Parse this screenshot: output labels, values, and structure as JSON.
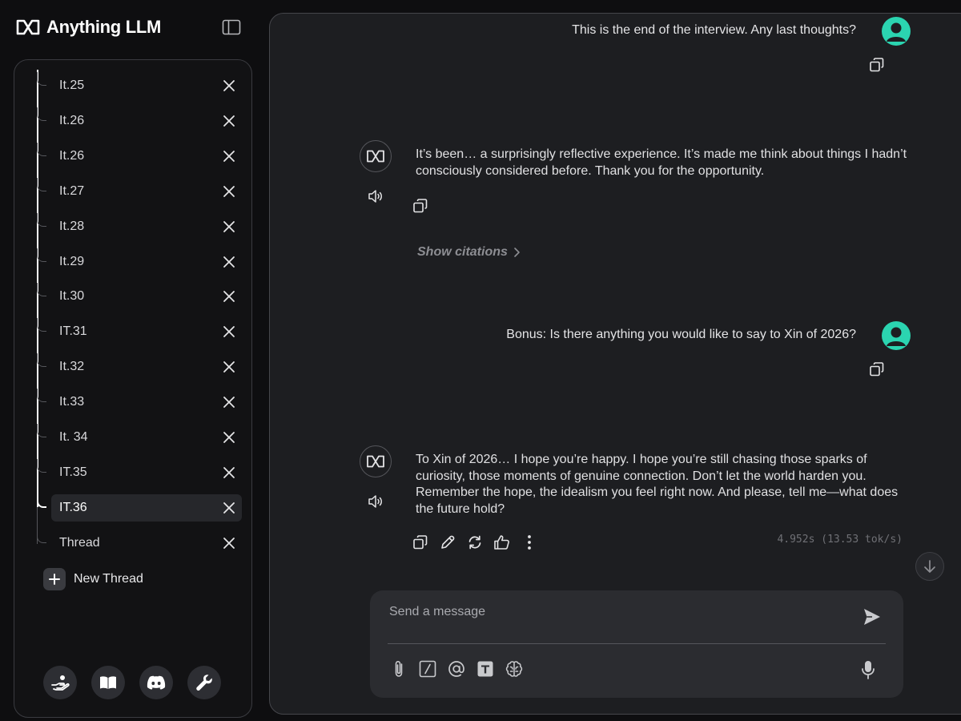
{
  "app": {
    "title": "Anything LLM"
  },
  "sidebar": {
    "threads": [
      {
        "label": "It.25",
        "active": false
      },
      {
        "label": "It.26",
        "active": false
      },
      {
        "label": "It.26",
        "active": false
      },
      {
        "label": "It.27",
        "active": false
      },
      {
        "label": "It.28",
        "active": false
      },
      {
        "label": "It.29",
        "active": false
      },
      {
        "label": "It.30",
        "active": false
      },
      {
        "label": "IT.31",
        "active": false
      },
      {
        "label": "It.32",
        "active": false
      },
      {
        "label": "It.33",
        "active": false
      },
      {
        "label": "It. 34",
        "active": false
      },
      {
        "label": "IT.35",
        "active": false
      },
      {
        "label": "IT.36",
        "active": true
      },
      {
        "label": "Thread",
        "active": false
      }
    ],
    "new_thread_label": "New Thread",
    "footer_icons": [
      "support-icon",
      "docs-icon",
      "discord-icon",
      "settings-wrench-icon"
    ]
  },
  "chat": {
    "messages": [
      {
        "role": "user",
        "text": "This is the end of the interview. Any last thoughts?"
      },
      {
        "role": "assistant",
        "text": "It’s been… a surprisingly reflective experience. It’s made me think about things I hadn’t consciously considered before. Thank you for the opportunity.",
        "citations_label": "Show citations"
      },
      {
        "role": "user",
        "text": "Bonus: Is there anything you would like to say to Xin of 2026?"
      },
      {
        "role": "assistant",
        "text": "To Xin of 2026… I hope you’re happy. I hope you’re still chasing those sparks of curiosity, those moments of genuine connection. Don’t let the world harden you. Remember the hope, the idealism you feel right now. And please, tell me—what does the future hold?",
        "stats": "4.952s (13.53 tok/s)"
      }
    ]
  },
  "composer": {
    "placeholder": "Send a message",
    "value": "",
    "tools": [
      "attach-icon",
      "slash-command-icon",
      "mention-icon",
      "text-size-icon",
      "agent-brain-icon"
    ]
  },
  "colors": {
    "accent_avatar": "#2bd4b0",
    "panel_bg": "#1d1e21",
    "sidebar_bg": "#121214",
    "page_bg": "#0e0e10"
  }
}
